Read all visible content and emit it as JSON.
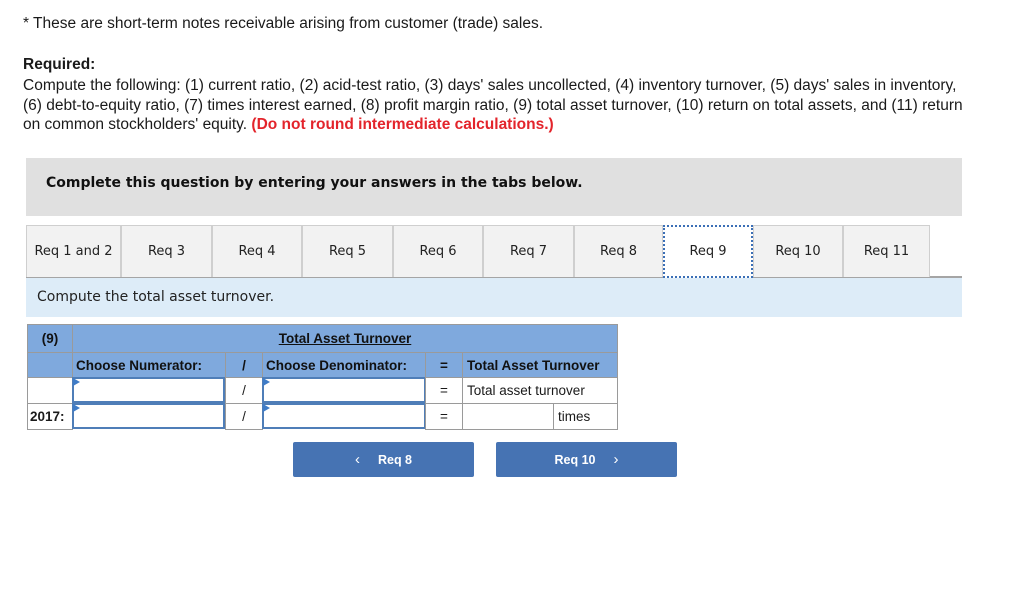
{
  "note": "* These are short-term notes receivable arising from customer (trade) sales.",
  "required": {
    "title": "Required:",
    "line1": "Compute the following: (1) current ratio, (2) acid-test ratio, (3) days' sales uncollected, (4) inventory turnover, (5) days' sales in inventory,",
    "line2": "(6) debt-to-equity ratio, (7) times interest earned, (8) profit margin ratio, (9) total asset turnover, (10) return on total assets, and (11) return",
    "line3": "on common stockholders' equity.",
    "warning": "(Do not round intermediate calculations.)"
  },
  "instruction": "Complete this question by entering your answers in the tabs below.",
  "tabs": [
    {
      "label": "Req 1 and 2",
      "active": false
    },
    {
      "label": "Req 3",
      "active": false
    },
    {
      "label": "Req 4",
      "active": false
    },
    {
      "label": "Req 5",
      "active": false
    },
    {
      "label": "Req 6",
      "active": false
    },
    {
      "label": "Req 7",
      "active": false
    },
    {
      "label": "Req 8",
      "active": false
    },
    {
      "label": "Req 9",
      "active": true
    },
    {
      "label": "Req 10",
      "active": false
    },
    {
      "label": "Req 11",
      "active": false
    }
  ],
  "prompt": "Compute the total asset turnover.",
  "table": {
    "req_number": "(9)",
    "title": "Total Asset Turnover",
    "numerator_header": "Choose Numerator:",
    "divide_symbol": "/",
    "denominator_header": "Choose Denominator:",
    "equals_symbol": "=",
    "result_header": "Total Asset Turnover",
    "rows": [
      {
        "label": "",
        "numerator": "",
        "denominator": "",
        "result": "Total asset turnover",
        "unit": ""
      },
      {
        "label": "2017:",
        "numerator": "",
        "denominator": "",
        "result": "",
        "unit": "times"
      }
    ]
  },
  "nav": {
    "prev_label": "Req 8",
    "next_label": "Req 10",
    "prev_icon": "‹",
    "next_icon": "›"
  }
}
